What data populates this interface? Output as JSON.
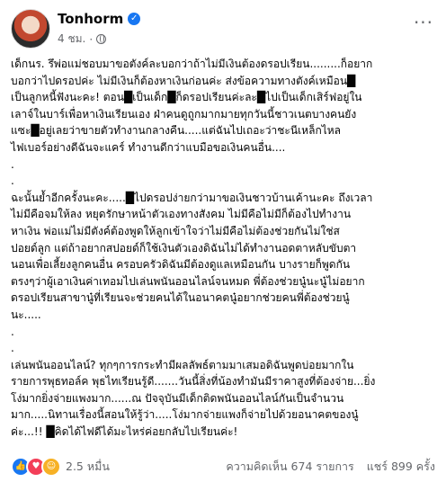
{
  "author": {
    "name": "Tonhorm",
    "verified_icon": "verified-badge-icon",
    "time": "4 ชม.",
    "privacy_icon": "globe-icon"
  },
  "more_icon": "more-horizontal-icon",
  "post_paragraphs": [
    "เด็กนร. รึพ่อแม่ชอบมาขอตังค์ละบอกว่าถ้าไม่มีเงินต้องดรอปเรียน.........ก็อยาก\nบอกว่าไปดรอปค่ะ ไม่มีเงินก็ต้องหาเงินก่อนค่ะ ส่งข้อความทางตังค์เหมือน█\nเป็นลูกหนี้ฟังนะคะ! ตอน█เป็นเด็ก█ก็ดรอปเรียนค่ะละ█ไปเป็นเด็กเสิร์ฟอยู่ใน\nเลาจ์ในบาร์เพื่อหาเงินเรียนเอง ฝ่าคนดูถูกมากมายทุกวันนี้ชาวเนตบางคนยัง\nแซะ█อยู่เลยว่าขายตัวทำงานกลางคืน.....แต่ฉันไปเถอะว่าชะนีเหล็กไหล\nไฟเบอร์อย่างดีฉันจะแคร์ ทำงานดีกว่าแบมือขอเงินคนอื่น....",
    ".",
    ".",
    "ฉะนั้นย้ำอีกครั้งนะคะ.....█ไปดรอปง่ายกว่ามาขอเงินชาวบ้านเค้านะคะ ถึงเวลา\nไม่มีคือจมให้ลง หยุดรักษาหน้าตัวเองทางสังคม ไม่มีคือไม่มีก็ต้องไปทำงาน\nหาเงิน พ่อแม่ไม่มีตังค์ต้องพูดให้ลูกเข้าใจว่าไม่มีคือไม่ต้องช่วยกันไม่ใช่ส\nปอยด์ลูก แต่ถ้าอยากสปอยด์ก็ใช้เงินตัวเองดิฉันไม่ได้ทำงานอดตาหลับขับตา\nนอนเพื่อเลี้ยงลูกคนอื่น ครอบครัวดิฉันมีต้องดูแลเหมือนกัน บางรายก็พูดกัน\nตรงๆว่าผู้เอาเงินค่าเทอมไปเล่นพนันออนไลน์จนหมด พี่ต้องช่วยนู๋นะนู๋ไม่อยาก\nดรอปเรียนสาขานู๋ที่เรียนจะช่วยคนได้ในอนาคตนู๋อยากช่วยคนพี่ต้องช่วยนู๋\nนะ.....",
    ".",
    ".",
    "เล่นพนันออนไลน์? ทุกๆการกระทำมีผลลัพธ์ตามมาเสมอดิฉันพูดบ่อยมากใน\nรายการพุธทอล์ค พุธไทเรียนรู้ดี.......วันนี้สิ่งที่น้องทำมันมีราคาสูงที่ต้องจ่าย...ยิ่ง\nโง่มากยิ่งจ่ายแพงมาก......ณ ปัจจุบันมีเด็กติดพนันออนไลน์กันเป็นจำนวน\nมาก.....นิทานเรื่องนี้สอนให้รู้ว่า.....โง่มากจ่ายแพงก็จ่ายไปด้วยอนาคตของนู๋\nค่ะ...!! █คิดได้ไฟดีได้มะไหร่ค่อยกลับไปเรียนค่ะ!"
  ],
  "reactions": {
    "icons": [
      "like-icon",
      "love-icon",
      "haha-icon"
    ],
    "count": "2.5 หมื่น"
  },
  "comments": "ความคิดเห็น 674 รายการ",
  "shares": "แชร์ 899 ครั้ง"
}
